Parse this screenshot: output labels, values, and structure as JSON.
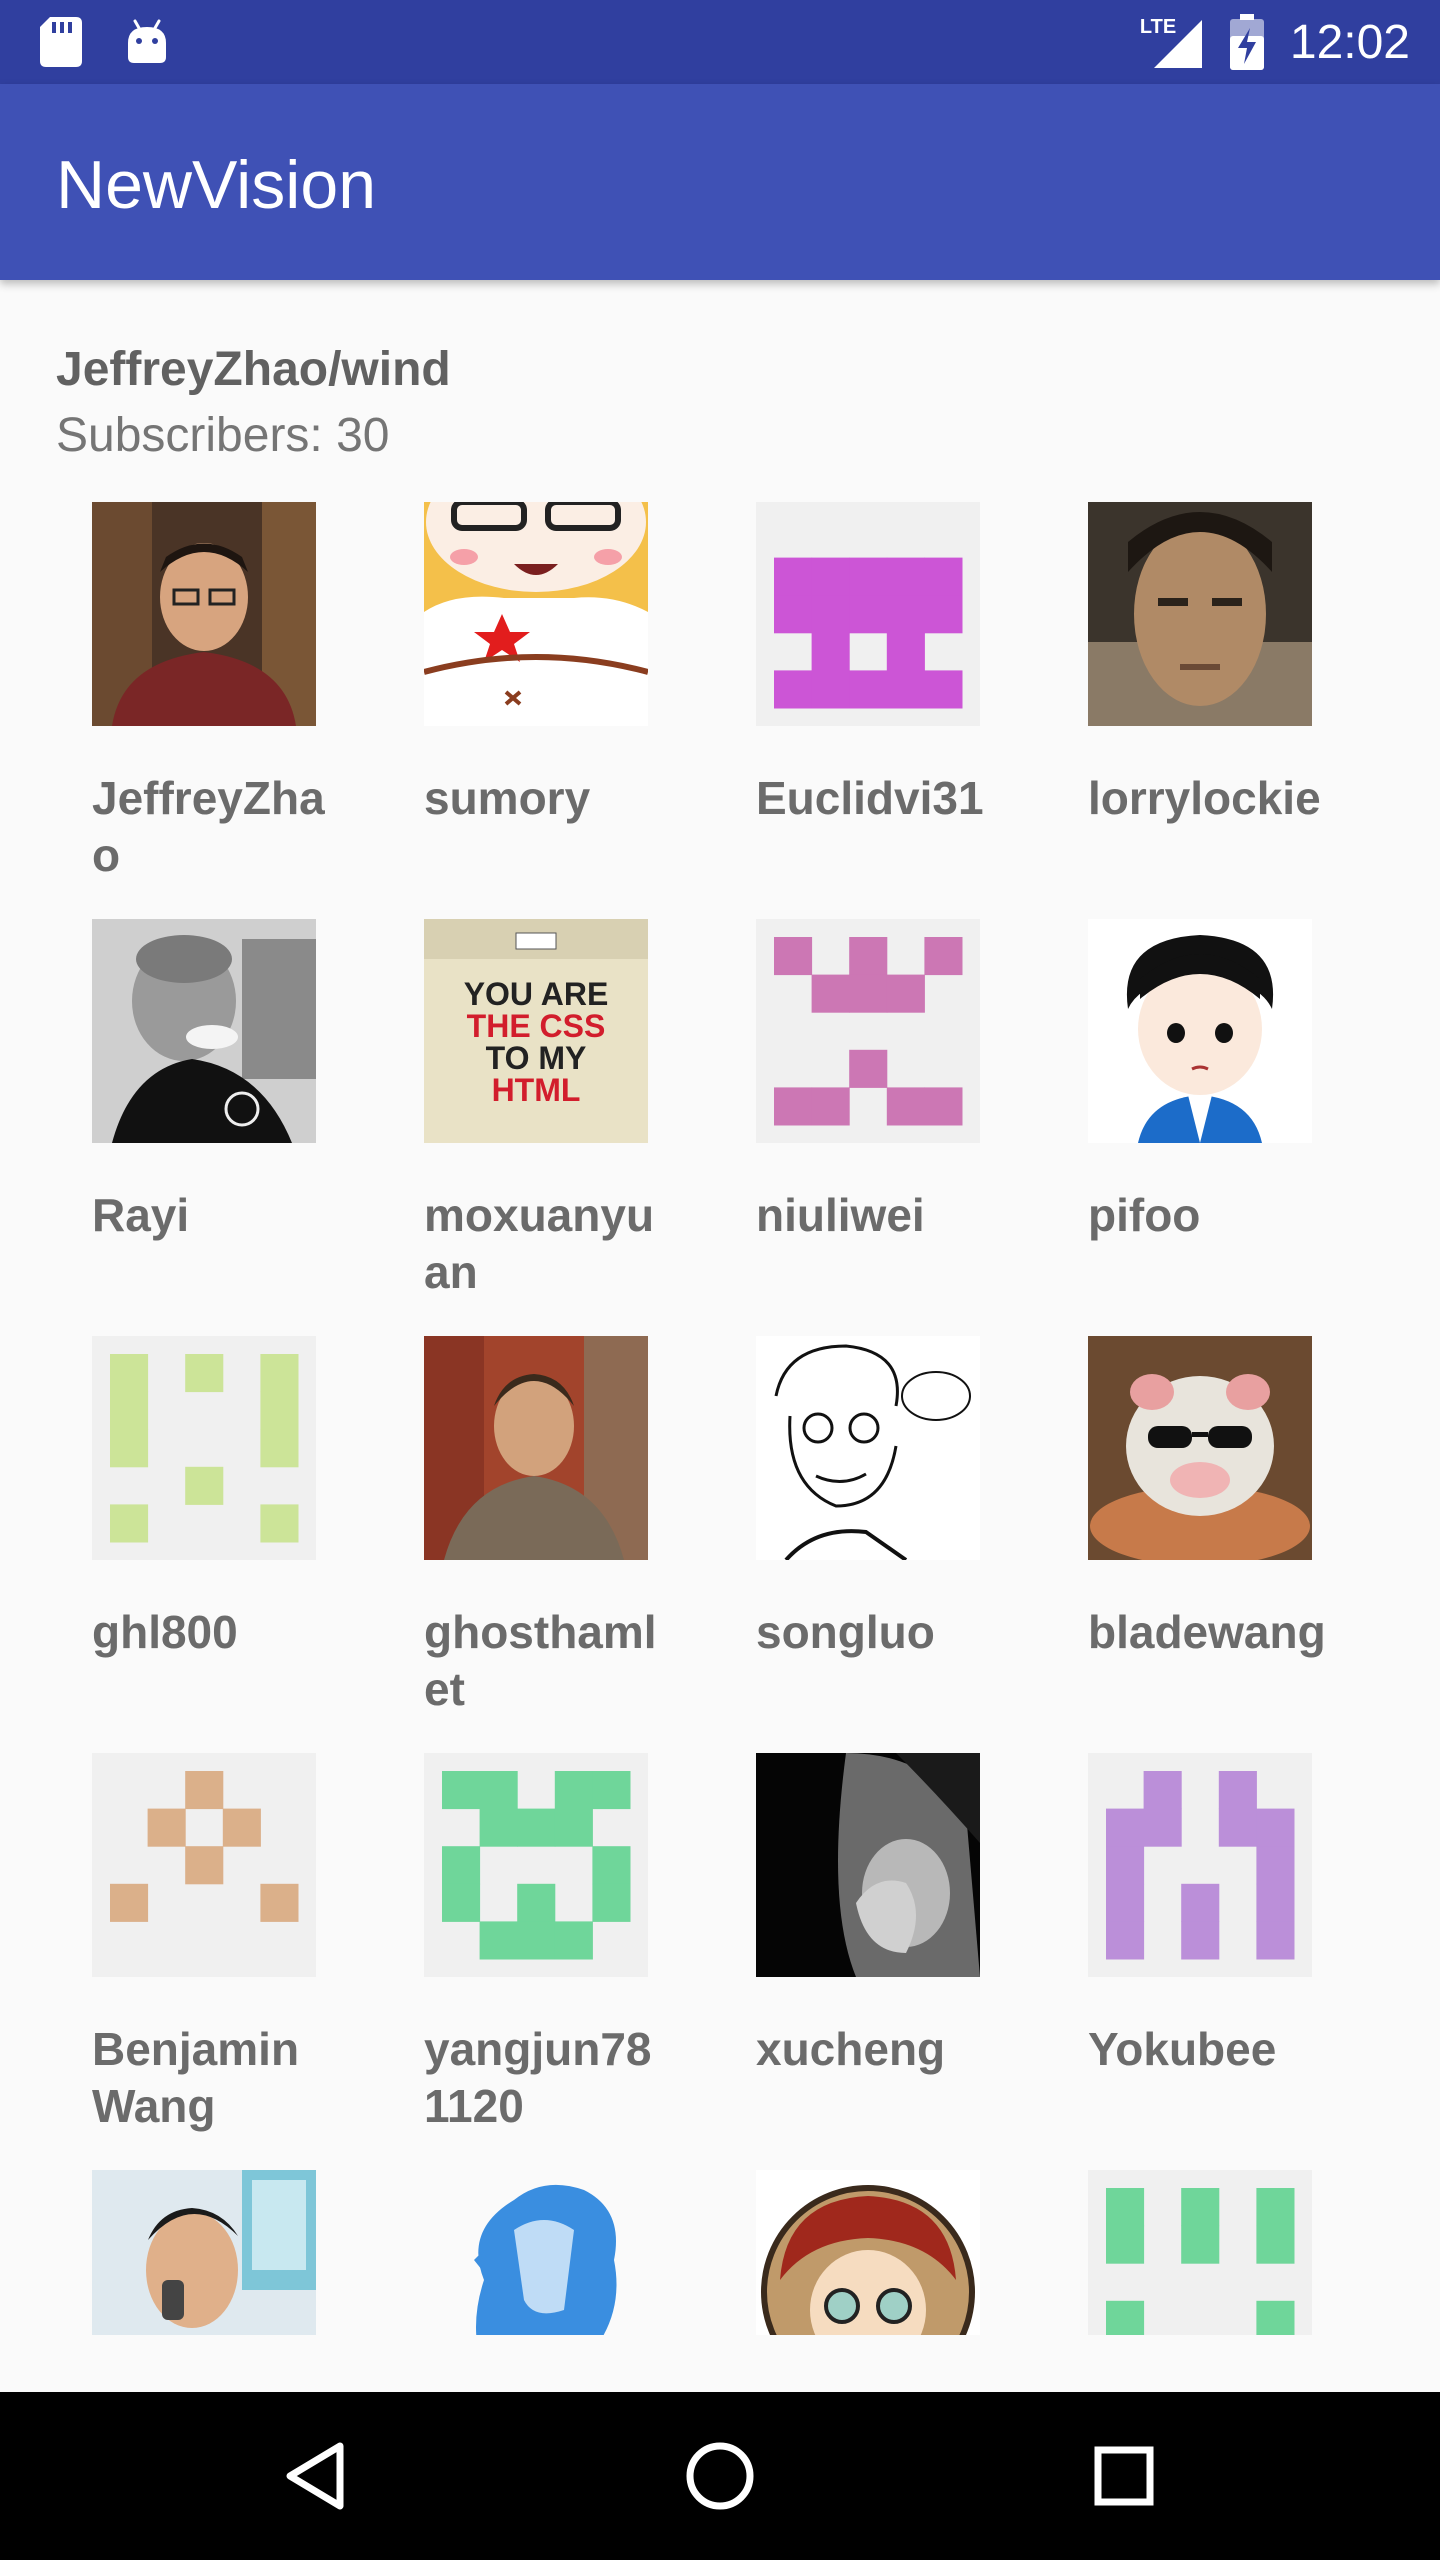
{
  "status_bar": {
    "time": "12:02",
    "network_label": "LTE",
    "icons": [
      "sd-card-icon",
      "android-icon",
      "lte-signal-icon",
      "battery-charging-icon"
    ]
  },
  "app_bar": {
    "title": "NewVision"
  },
  "header": {
    "repo": "JeffreyZhao/wind",
    "subscribers_text": "Subscribers: 30"
  },
  "subscribers": [
    {
      "name": "JeffreyZhao",
      "avatar": "photo-man-glasses"
    },
    {
      "name": "sumory",
      "avatar": "cartoon-pig"
    },
    {
      "name": "Euclidvi31",
      "avatar": "identicon",
      "color": "#cc55d6"
    },
    {
      "name": "lorrylockie",
      "avatar": "photo-young-man"
    },
    {
      "name": "Rayi",
      "avatar": "photo-bw-man-spoon"
    },
    {
      "name": "moxuanyuan",
      "avatar": "photo-css-tshirt",
      "text": [
        "YOU ARE",
        "THE CSS",
        "TO MY",
        "HTML"
      ]
    },
    {
      "name": "niuliwei",
      "avatar": "identicon",
      "color": "#cc77b4"
    },
    {
      "name": "pifoo",
      "avatar": "cartoon-boy"
    },
    {
      "name": "ghl800",
      "avatar": "identicon",
      "color": "#cce498"
    },
    {
      "name": "ghosthamlet",
      "avatar": "photo-man-wall"
    },
    {
      "name": "songluo",
      "avatar": "sketch-man"
    },
    {
      "name": "bladewang",
      "avatar": "photo-plush-pig"
    },
    {
      "name": "BenjaminWang",
      "avatar": "identicon",
      "color": "#dbb08a"
    },
    {
      "name": "yangjun781120",
      "avatar": "identicon",
      "color": "#6fd69a"
    },
    {
      "name": "xucheng",
      "avatar": "photo-bw-man-hand"
    },
    {
      "name": "Yokubee",
      "avatar": "identicon",
      "color": "#bb8fd9"
    },
    {
      "name": "",
      "avatar": "photo-man-phone"
    },
    {
      "name": "",
      "avatar": "anime-silhouette-blue"
    },
    {
      "name": "",
      "avatar": "anime-red-hair"
    },
    {
      "name": "",
      "avatar": "identicon",
      "color": "#6fd69a"
    }
  ],
  "nav_bar": {
    "buttons": [
      "back-icon",
      "home-icon",
      "recents-icon"
    ]
  }
}
